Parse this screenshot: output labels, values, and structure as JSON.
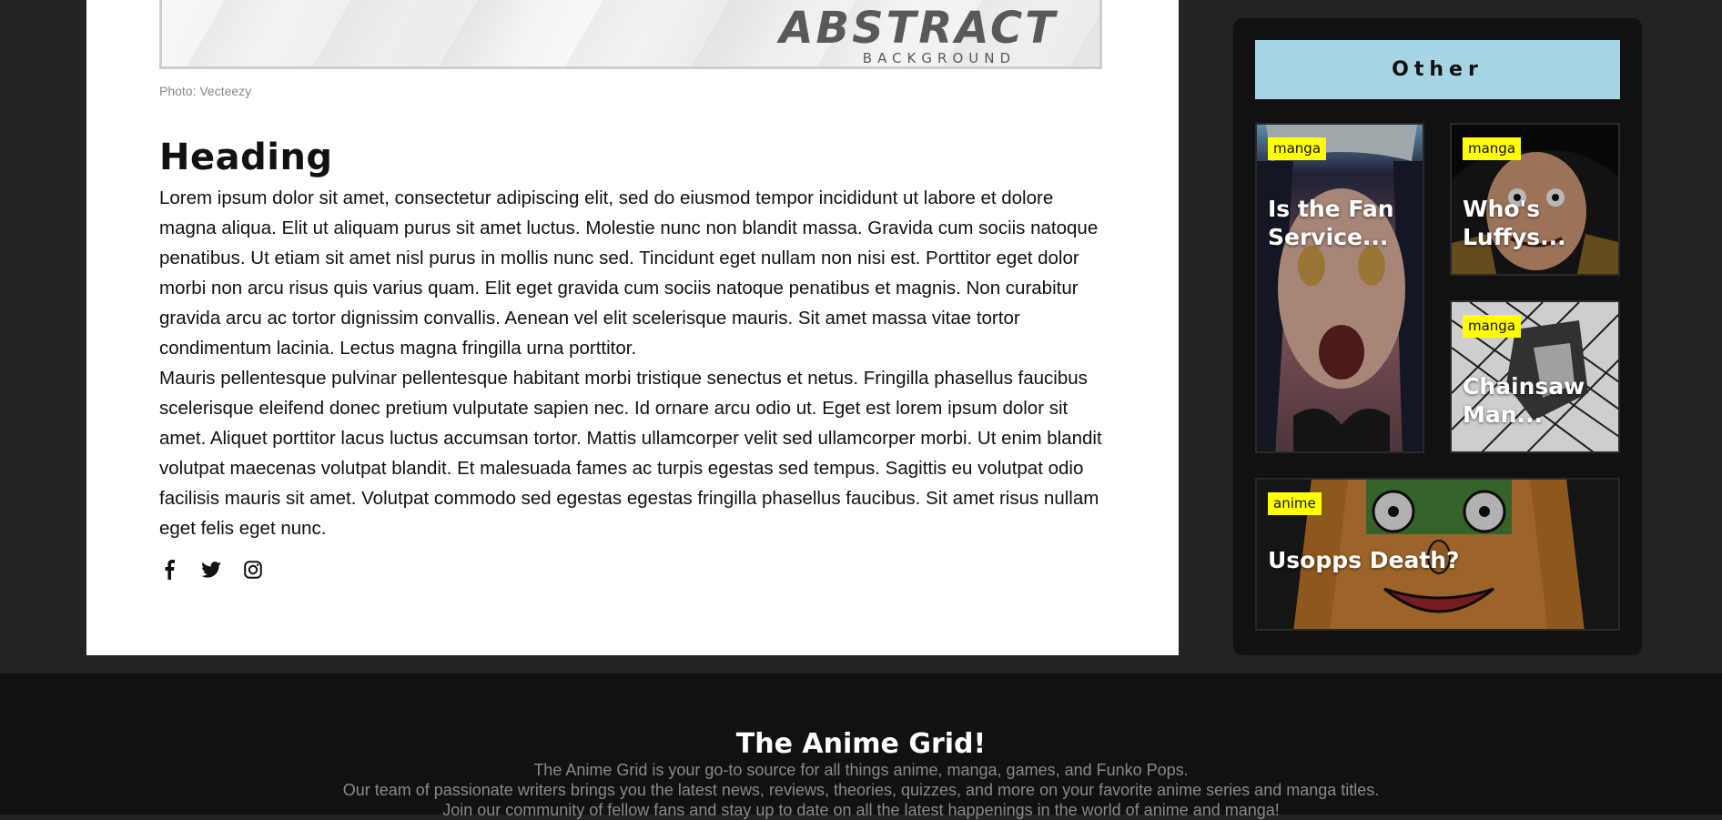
{
  "hero": {
    "title": "ABSTRACT",
    "subtitle": "BACKGROUND",
    "credit": "Photo: Vecteezy"
  },
  "article": {
    "heading": "Heading",
    "paragraphs": [
      "Lorem ipsum dolor sit amet, consectetur adipiscing elit, sed do eiusmod tempor incididunt ut labore et dolore magna aliqua. Elit ut aliquam purus sit amet luctus. Molestie nunc non blandit massa. Gravida cum sociis natoque penatibus. Ut etiam sit amet nisl purus in mollis nunc sed. Tincidunt eget nullam non nisi est. Porttitor eget dolor morbi non arcu risus quis varius quam. Elit eget gravida cum sociis natoque penatibus et magnis. Non curabitur gravida arcu ac tortor dignissim convallis. Aenean vel elit scelerisque mauris. Sit amet massa vitae tortor condimentum lacinia. Lectus magna fringilla urna porttitor.",
      "Mauris pellentesque pulvinar pellentesque habitant morbi tristique senectus et netus. Fringilla phasellus faucibus scelerisque eleifend donec pretium vulputate sapien nec. Id ornare arcu odio ut. Eget est lorem ipsum dolor sit amet. Aliquet porttitor lacus luctus accumsan tortor. Mattis ullamcorper velit sed ullamcorper morbi. Ut enim blandit volutpat maecenas volutpat blandit. Et malesuada fames ac turpis egestas sed tempus. Sagittis eu volutpat odio facilisis mauris sit amet. Volutpat commodo sed egestas egestas fringilla phasellus faucibus. Sit amet risus nullam eget felis eget nunc."
    ],
    "social": [
      "facebook-icon",
      "twitter-icon",
      "instagram-icon"
    ]
  },
  "sidebar": {
    "title": "Other",
    "cards": [
      {
        "tag": "manga",
        "title": "Is the Fan Service..."
      },
      {
        "tag": "manga",
        "title": "Who's Luffys..."
      },
      {
        "tag": "manga",
        "title": "Chainsaw Man..."
      },
      {
        "tag": "anime",
        "title": "Usopps Death?"
      }
    ]
  },
  "footer": {
    "title": "The Anime Grid!",
    "lines": [
      "The Anime Grid is your go-to source for all things anime, manga, games, and Funko Pops.",
      "Our team of passionate writers brings you the latest news, reviews, theories, quizzes, and more on your favorite anime series and manga titles.",
      "Join our community of fellow fans and stay up to date on all the latest happenings in the world of anime and manga!"
    ]
  },
  "colors": {
    "page_bg": "#232323",
    "sidebar_bg": "#111111",
    "sidebar_title_bg": "#a8d5e4",
    "tag_bg": "#ffff00",
    "footer_bg": "#111111"
  }
}
